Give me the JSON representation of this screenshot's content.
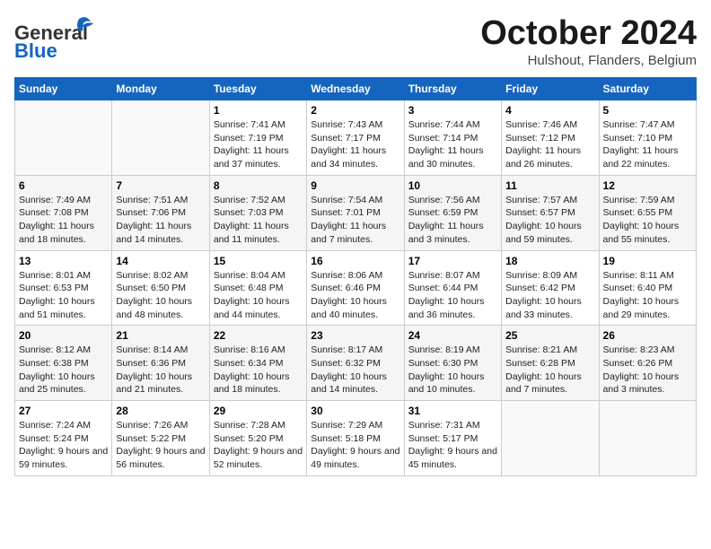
{
  "header": {
    "logo_line1": "General",
    "logo_line2": "Blue",
    "month": "October 2024",
    "location": "Hulshout, Flanders, Belgium"
  },
  "weekdays": [
    "Sunday",
    "Monday",
    "Tuesday",
    "Wednesday",
    "Thursday",
    "Friday",
    "Saturday"
  ],
  "weeks": [
    [
      {
        "day": "",
        "info": ""
      },
      {
        "day": "",
        "info": ""
      },
      {
        "day": "1",
        "info": "Sunrise: 7:41 AM\nSunset: 7:19 PM\nDaylight: 11 hours and 37 minutes."
      },
      {
        "day": "2",
        "info": "Sunrise: 7:43 AM\nSunset: 7:17 PM\nDaylight: 11 hours and 34 minutes."
      },
      {
        "day": "3",
        "info": "Sunrise: 7:44 AM\nSunset: 7:14 PM\nDaylight: 11 hours and 30 minutes."
      },
      {
        "day": "4",
        "info": "Sunrise: 7:46 AM\nSunset: 7:12 PM\nDaylight: 11 hours and 26 minutes."
      },
      {
        "day": "5",
        "info": "Sunrise: 7:47 AM\nSunset: 7:10 PM\nDaylight: 11 hours and 22 minutes."
      }
    ],
    [
      {
        "day": "6",
        "info": "Sunrise: 7:49 AM\nSunset: 7:08 PM\nDaylight: 11 hours and 18 minutes."
      },
      {
        "day": "7",
        "info": "Sunrise: 7:51 AM\nSunset: 7:06 PM\nDaylight: 11 hours and 14 minutes."
      },
      {
        "day": "8",
        "info": "Sunrise: 7:52 AM\nSunset: 7:03 PM\nDaylight: 11 hours and 11 minutes."
      },
      {
        "day": "9",
        "info": "Sunrise: 7:54 AM\nSunset: 7:01 PM\nDaylight: 11 hours and 7 minutes."
      },
      {
        "day": "10",
        "info": "Sunrise: 7:56 AM\nSunset: 6:59 PM\nDaylight: 11 hours and 3 minutes."
      },
      {
        "day": "11",
        "info": "Sunrise: 7:57 AM\nSunset: 6:57 PM\nDaylight: 10 hours and 59 minutes."
      },
      {
        "day": "12",
        "info": "Sunrise: 7:59 AM\nSunset: 6:55 PM\nDaylight: 10 hours and 55 minutes."
      }
    ],
    [
      {
        "day": "13",
        "info": "Sunrise: 8:01 AM\nSunset: 6:53 PM\nDaylight: 10 hours and 51 minutes."
      },
      {
        "day": "14",
        "info": "Sunrise: 8:02 AM\nSunset: 6:50 PM\nDaylight: 10 hours and 48 minutes."
      },
      {
        "day": "15",
        "info": "Sunrise: 8:04 AM\nSunset: 6:48 PM\nDaylight: 10 hours and 44 minutes."
      },
      {
        "day": "16",
        "info": "Sunrise: 8:06 AM\nSunset: 6:46 PM\nDaylight: 10 hours and 40 minutes."
      },
      {
        "day": "17",
        "info": "Sunrise: 8:07 AM\nSunset: 6:44 PM\nDaylight: 10 hours and 36 minutes."
      },
      {
        "day": "18",
        "info": "Sunrise: 8:09 AM\nSunset: 6:42 PM\nDaylight: 10 hours and 33 minutes."
      },
      {
        "day": "19",
        "info": "Sunrise: 8:11 AM\nSunset: 6:40 PM\nDaylight: 10 hours and 29 minutes."
      }
    ],
    [
      {
        "day": "20",
        "info": "Sunrise: 8:12 AM\nSunset: 6:38 PM\nDaylight: 10 hours and 25 minutes."
      },
      {
        "day": "21",
        "info": "Sunrise: 8:14 AM\nSunset: 6:36 PM\nDaylight: 10 hours and 21 minutes."
      },
      {
        "day": "22",
        "info": "Sunrise: 8:16 AM\nSunset: 6:34 PM\nDaylight: 10 hours and 18 minutes."
      },
      {
        "day": "23",
        "info": "Sunrise: 8:17 AM\nSunset: 6:32 PM\nDaylight: 10 hours and 14 minutes."
      },
      {
        "day": "24",
        "info": "Sunrise: 8:19 AM\nSunset: 6:30 PM\nDaylight: 10 hours and 10 minutes."
      },
      {
        "day": "25",
        "info": "Sunrise: 8:21 AM\nSunset: 6:28 PM\nDaylight: 10 hours and 7 minutes."
      },
      {
        "day": "26",
        "info": "Sunrise: 8:23 AM\nSunset: 6:26 PM\nDaylight: 10 hours and 3 minutes."
      }
    ],
    [
      {
        "day": "27",
        "info": "Sunrise: 7:24 AM\nSunset: 5:24 PM\nDaylight: 9 hours and 59 minutes."
      },
      {
        "day": "28",
        "info": "Sunrise: 7:26 AM\nSunset: 5:22 PM\nDaylight: 9 hours and 56 minutes."
      },
      {
        "day": "29",
        "info": "Sunrise: 7:28 AM\nSunset: 5:20 PM\nDaylight: 9 hours and 52 minutes."
      },
      {
        "day": "30",
        "info": "Sunrise: 7:29 AM\nSunset: 5:18 PM\nDaylight: 9 hours and 49 minutes."
      },
      {
        "day": "31",
        "info": "Sunrise: 7:31 AM\nSunset: 5:17 PM\nDaylight: 9 hours and 45 minutes."
      },
      {
        "day": "",
        "info": ""
      },
      {
        "day": "",
        "info": ""
      }
    ]
  ]
}
